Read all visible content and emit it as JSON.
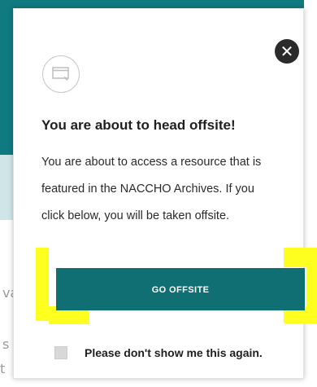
{
  "background": {
    "fragments": [
      "va",
      "s",
      "t"
    ]
  },
  "modal": {
    "close_icon": "close-icon",
    "offsite_icon": "browser-window-icon",
    "title": "You are about to head offsite!",
    "body_lines": [
      "You are about to access a resource that is",
      "featured in the NACCHO Archives. If you",
      "click below, you will be taken offsite."
    ],
    "go_offsite_label": "GO OFFSITE",
    "dont_show_label": "Please don't show me this again."
  },
  "colors": {
    "accent": "#0f6f72",
    "highlight": "#ffff1f",
    "close_bg": "#2b2b2b"
  }
}
